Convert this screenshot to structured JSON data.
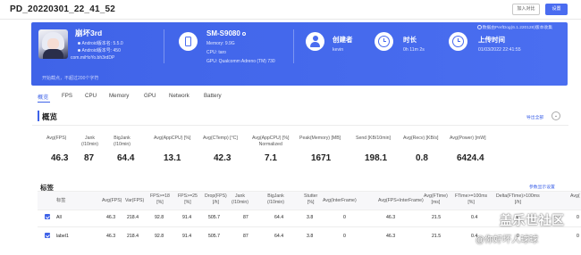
{
  "header": {
    "title": "PD_20220301_22_41_52",
    "compare_label": "加入对比",
    "settings_label": "设置"
  },
  "banner": {
    "corner_note": "数据由PerfDog(6.1.220128)版本收集",
    "game": {
      "name": "崩坏3rd",
      "version_name": "Android版本名: 5.5.0",
      "version_code": "Android版本号: 450",
      "package": "com.miHoYo.bh3rdDP"
    },
    "device": {
      "model": "SM-S9080",
      "memory": "Memory: 9.9G",
      "cpu": "CPU: taro",
      "gpu": "GPU: Qualcomm Adreno (TM) 730"
    },
    "creator": {
      "label": "创建者",
      "value": "kevin"
    },
    "duration": {
      "label": "时长",
      "value": "0h 11m 2s"
    },
    "upload": {
      "label": "上传时间",
      "value": "01/03/2022 22:41:55"
    },
    "notice": "开始截点，不超过200个字符"
  },
  "tabs": [
    {
      "label": "概览",
      "active": true
    },
    {
      "label": "FPS"
    },
    {
      "label": "CPU"
    },
    {
      "label": "Memory"
    },
    {
      "label": "GPU"
    },
    {
      "label": "Network"
    },
    {
      "label": "Battery"
    }
  ],
  "overview": {
    "title": "概览",
    "export_label": "导出全部",
    "collapse_icon": "chevron-down-icon",
    "metrics": [
      {
        "label": "Avg(FPS)",
        "value": "46.3"
      },
      {
        "label": "Jank\n(/10min)",
        "value": "87"
      },
      {
        "label": "BigJank\n(/10min)",
        "value": "64.4"
      },
      {
        "label": "Avg(AppCPU) [%]",
        "value": "13.1"
      },
      {
        "label": "Avg(CTemp) [°C]",
        "value": "42.3"
      },
      {
        "label": "Avg(AppCPU) [%]\nNormalized",
        "value": "7.1"
      },
      {
        "label": "Peak(Memory) [MB]",
        "value": "1671"
      },
      {
        "label": "Send [KB/10min]",
        "value": "198.1"
      },
      {
        "label": "Avg(Recv) [KB/s]",
        "value": "0.8"
      },
      {
        "label": "Avg(Power) [mW]",
        "value": "6424.4"
      }
    ]
  },
  "tags": {
    "title": "标签",
    "param_label": "参数显示设置",
    "columns": [
      "标签",
      "Avg(FPS)",
      "Var(FPS)",
      "FPS>=18\n[%]",
      "FPS>=25\n[%]",
      "Drop(FPS)\n[/h]",
      "Jank\n(/10min)",
      "BigJank\n(/10min)",
      "Stutter\n[%]",
      "Avg(InterFrame)",
      "Avg(FPS+InterFrame)",
      "Avg(FTime)\n[ms]",
      "FTime>=100ms\n[%]",
      "Delta(FTime)>100ms\n[/h]",
      "Avg("
    ],
    "rows": [
      {
        "label": "All",
        "cells": [
          "46.3",
          "218.4",
          "92.8",
          "91.4",
          "505.7",
          "87",
          "64.4",
          "3.8",
          "0",
          "46.3",
          "21.5",
          "0.4",
          "0",
          "0"
        ]
      },
      {
        "label": "label1",
        "cells": [
          "46.3",
          "218.4",
          "92.8",
          "91.4",
          "505.7",
          "87",
          "64.4",
          "3.8",
          "0",
          "46.3",
          "21.5",
          "0.4",
          "0",
          "0"
        ]
      }
    ]
  },
  "watermark": {
    "site": "盖乐世社区",
    "user": "@你好坏人球球"
  }
}
